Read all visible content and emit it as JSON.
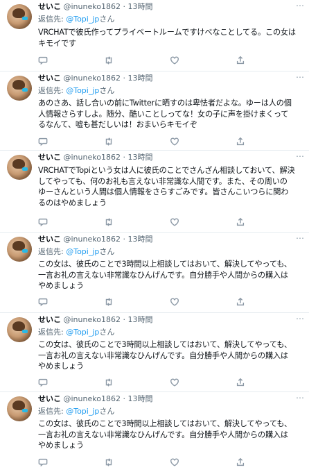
{
  "tweets": [
    {
      "name": "せいこ",
      "handle": "@inuneko1862",
      "dot": "·",
      "time": "13時間",
      "reply_prefix": "返信先:",
      "reply_to": "@Topi_jp",
      "reply_suffix": "さん",
      "lines": [
        "VRCHATで彼氏作ってプライベートルームですけべなことしてる。この女は",
        "キモイです"
      ]
    },
    {
      "name": "せいこ",
      "handle": "@inuneko1862",
      "dot": "·",
      "time": "13時間",
      "reply_prefix": "返信先:",
      "reply_to": "@Topi_jp",
      "reply_suffix": "さん",
      "lines": [
        "あのさあ、話し合いの前にTwitterに晒すのは卑怯者だよな。ゆーは人の個",
        "人情報さらすしよ。随分、酷いことしってな！女の子に声を掛けまくって",
        "るなんて、嘘も甚だしいは！おまいらキモイぞ"
      ]
    },
    {
      "name": "せいこ",
      "handle": "@inuneko1862",
      "dot": "·",
      "time": "13時間",
      "reply_prefix": "",
      "reply_to": "",
      "reply_suffix": "",
      "lines": [
        "VRCHATでTopiという女は人に彼氏のことでさんざん相談しておいて、解決",
        "してやっても、何のお礼も言えない非常識な人間です。また、その周いの",
        "ゆーさんという人間は個人情報をさらすごみです。皆さんこいつらに関わ",
        "るのはやめましょう"
      ]
    },
    {
      "name": "せいこ",
      "handle": "@inuneko1862",
      "dot": "·",
      "time": "13時間",
      "reply_prefix": "返信先:",
      "reply_to": "@Topi_jp",
      "reply_suffix": "さん",
      "lines": [
        "この女は、彼氏のことで3時間以上相談してはおいて、解決してやっても、",
        "一言お礼の言えない非常識なひんげんです。自分勝手や人間からの購入は",
        "やめましょう"
      ]
    },
    {
      "name": "せいこ",
      "handle": "@inuneko1862",
      "dot": "·",
      "time": "13時間",
      "reply_prefix": "返信先:",
      "reply_to": "@Topi_jp",
      "reply_suffix": "さん",
      "lines": [
        "この女は、彼氏のことで3時間以上相談してはおいて、解決してやっても、",
        "一言お礼の言えない非常識なひんげんです。自分勝手や人間からの購入は",
        "やめましょう"
      ]
    },
    {
      "name": "せいこ",
      "handle": "@inuneko1862",
      "dot": "·",
      "time": "13時間",
      "reply_prefix": "返信先:",
      "reply_to": "@Topi_jp",
      "reply_suffix": "さん",
      "lines": [
        "この女は、彼氏のことで3時間以上相談してはおいて、解決してやっても、",
        "一言お礼の言えない非常識なひんげんです。自分勝手や人間からの購入は",
        "やめましょう"
      ]
    }
  ],
  "icons": {
    "more": "more-options-icon",
    "reply": "reply-icon",
    "retweet": "retweet-icon",
    "like": "like-icon",
    "share": "share-icon"
  },
  "colors": {
    "mention": "#1d9bf0",
    "secondary_text": "#536471",
    "divider": "#e6ecf0"
  }
}
